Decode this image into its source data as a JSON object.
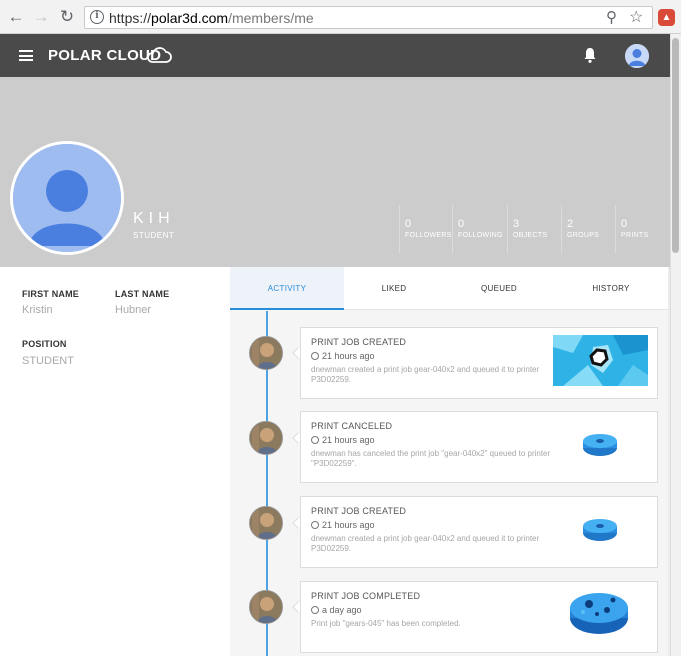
{
  "browser": {
    "url_scheme": "https://",
    "url_host": "polar3d.com",
    "url_path": "/members/me"
  },
  "app": {
    "logo_text": "POLAR CLOUD"
  },
  "profile": {
    "name": "KIH",
    "role": "STUDENT",
    "stats": [
      {
        "value": "0",
        "label": "FOLLOWERS"
      },
      {
        "value": "0",
        "label": "FOLLOWING"
      },
      {
        "value": "3",
        "label": "OBJECTS"
      },
      {
        "value": "2",
        "label": "GROUPS"
      },
      {
        "value": "0",
        "label": "PRINTS"
      }
    ]
  },
  "details": {
    "first_name_label": "FIRST NAME",
    "first_name": "Kristin",
    "last_name_label": "LAST NAME",
    "last_name": "Hubner",
    "position_label": "POSITION",
    "position": "STUDENT"
  },
  "tabs": [
    {
      "label": "ACTIVITY",
      "active": true
    },
    {
      "label": "LIKED",
      "active": false
    },
    {
      "label": "QUEUED",
      "active": false
    },
    {
      "label": "HISTORY",
      "active": false
    }
  ],
  "activity": [
    {
      "title": "PRINT JOB CREATED",
      "time": "21 hours ago",
      "desc": "dnewman created a print job gear-040x2 and queued it to printer P3D02259."
    },
    {
      "title": "PRINT CANCELED",
      "time": "21 hours ago",
      "desc": "dnewman has canceled the print job \"gear-040x2\" queued to printer \"P3D02259\"."
    },
    {
      "title": "PRINT JOB CREATED",
      "time": "21 hours ago",
      "desc": "dnewman created a print job gear-040x2 and queued it to printer P3D02259."
    },
    {
      "title": "PRINT JOB COMPLETED",
      "time": "a day ago",
      "desc": "Print job \"gears-045\" has been completed."
    }
  ],
  "colors": {
    "accent": "#2a8cd8",
    "appbar": "#4a4a4a",
    "banner": "#cccccc"
  }
}
